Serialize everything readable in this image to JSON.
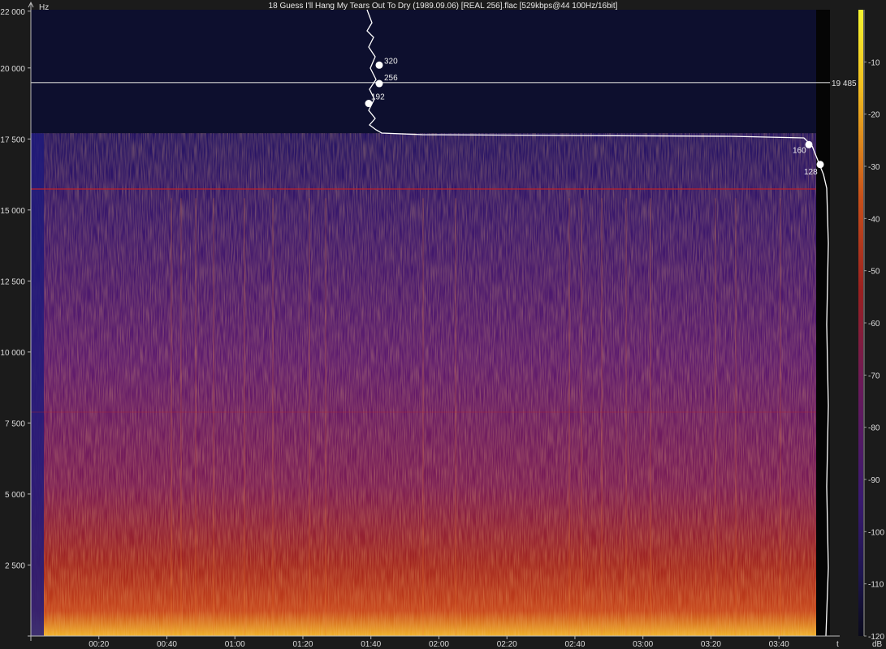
{
  "title": "18 Guess I'll Hang My Tears Out To Dry (1989.09.06) [REAL 256].flac [529kbps@44 100Hz/16bit]",
  "chart_data": {
    "type": "heatmap",
    "title": "18 Guess I'll Hang My Tears Out To Dry (1989.09.06) [REAL 256].flac [529kbps@44 100Hz/16bit]",
    "xlabel": "t",
    "ylabel": "Hz",
    "colorbar_label": "dB",
    "x_ticks": [
      "00:20",
      "00:40",
      "01:00",
      "01:20",
      "01:40",
      "02:00",
      "02:20",
      "02:40",
      "03:00",
      "03:20",
      "03:40"
    ],
    "x_tick_seconds": [
      20,
      40,
      60,
      80,
      100,
      120,
      140,
      160,
      180,
      200,
      220
    ],
    "xlim_seconds": [
      0,
      235
    ],
    "y_ticks": [
      "22 000",
      "20 000",
      "17 500",
      "15 000",
      "12 500",
      "10 000",
      "7 500",
      "5 000",
      "2 500"
    ],
    "y_tick_values": [
      22000,
      20000,
      17500,
      15000,
      12500,
      10000,
      7500,
      5000,
      2500
    ],
    "ylim": [
      0,
      22050
    ],
    "color_ticks": [
      "-10",
      "-20",
      "-30",
      "-40",
      "-50",
      "-60",
      "-70",
      "-80",
      "-90",
      "-100",
      "-110",
      "-120"
    ],
    "color_tick_values": [
      -10,
      -20,
      -30,
      -40,
      -50,
      -60,
      -70,
      -80,
      -90,
      -100,
      -110,
      -120
    ],
    "color_range_db": [
      -120,
      0
    ],
    "cutoff_frequency_hz": 17700,
    "reference_line": {
      "value": 19485,
      "label": "19 485"
    },
    "markers": [
      {
        "label": "320",
        "hz": 20100
      },
      {
        "label": "256",
        "hz": 19450
      },
      {
        "label": "192",
        "hz": 18750
      },
      {
        "label": "160",
        "hz": 17300
      },
      {
        "label": "128",
        "hz": 16600
      }
    ],
    "colors": {
      "background": "#1b1b1b",
      "above_cutoff": "#0d0f2e",
      "low": "#1a1560",
      "mid": "#5c1a6e",
      "high": "#b22a1e",
      "peak": "#f2c020",
      "colorbar_top": "#f0f030"
    }
  }
}
